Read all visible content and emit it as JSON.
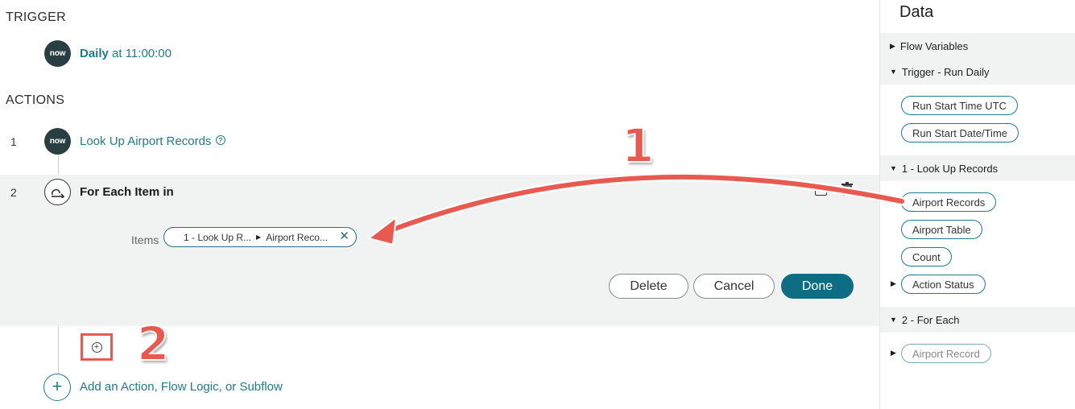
{
  "trigger": {
    "section_title": "TRIGGER",
    "badge": "now",
    "schedule_bold": "Daily",
    "schedule_rest": " at 11:00:00"
  },
  "actions": {
    "section_title": "ACTIONS",
    "step1": {
      "num": "1",
      "badge": "now",
      "label": "Look Up Airport Records",
      "help": "?"
    },
    "step2": {
      "num": "2",
      "label": "For Each Item in"
    },
    "items_label": "Items",
    "items_pill": {
      "part1": "1 - Look Up R...",
      "sep": "▶",
      "part2": "Airport Reco...",
      "clear": "✕"
    },
    "buttons": {
      "delete": "Delete",
      "cancel": "Cancel",
      "done": "Done"
    },
    "add_icon": "+",
    "add_link": "Add an Action, Flow Logic, or Subflow"
  },
  "callouts": {
    "one": "1",
    "two": "2"
  },
  "data_panel": {
    "title": "Data",
    "flow_variables": "Flow Variables",
    "trigger_group": "Trigger - Run Daily",
    "trigger_pills": [
      "Run Start Time UTC",
      "Run Start Date/Time"
    ],
    "lookup_group": "1 - Look Up Records",
    "lookup_pills": [
      "Airport Records",
      "Airport Table",
      "Count",
      "Action Status"
    ],
    "foreach_group": "2 - For Each",
    "foreach_pills": [
      "Airport Record"
    ]
  },
  "colors": {
    "accent": "#1f7a8c",
    "primary_button": "#0e6d83",
    "callout": "#e85a50",
    "panel_bg": "#f1f2f2"
  }
}
